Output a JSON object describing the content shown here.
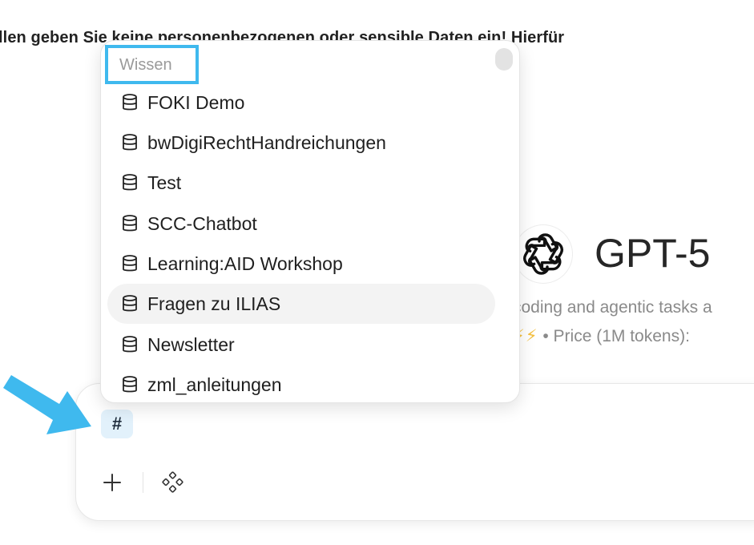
{
  "banner": {
    "text": "llen geben Sie keine personenbezogenen oder sensible Daten ein! Hierfür"
  },
  "model": {
    "name": "GPT-5",
    "description": "coding and agentic tasks a",
    "speed_bolts": "⚡⚡",
    "price_text": "• Price (1M tokens): ",
    "logo_icon": "openai-logo-icon"
  },
  "dropdown": {
    "header": "Wissen",
    "highlight_color": "#3fb9ee",
    "items": [
      {
        "label": "FOKI Demo",
        "icon": "database-icon"
      },
      {
        "label": "bwDigiRechtHandreichungen",
        "icon": "database-icon"
      },
      {
        "label": "Test",
        "icon": "database-icon"
      },
      {
        "label": "SCC-Chatbot",
        "icon": "database-icon"
      },
      {
        "label": "Learning:AID Workshop",
        "icon": "database-icon"
      },
      {
        "label": "Fragen zu ILIAS",
        "icon": "database-icon",
        "highlighted": true
      },
      {
        "label": "Newsletter",
        "icon": "database-icon"
      },
      {
        "label": "zml_anleitungen",
        "icon": "database-icon"
      }
    ]
  },
  "composer": {
    "input_value": "#",
    "plus_icon": "plus-icon",
    "tools_icon": "integrations-icon"
  },
  "annotation": {
    "arrow_color": "#3fb9ee"
  }
}
